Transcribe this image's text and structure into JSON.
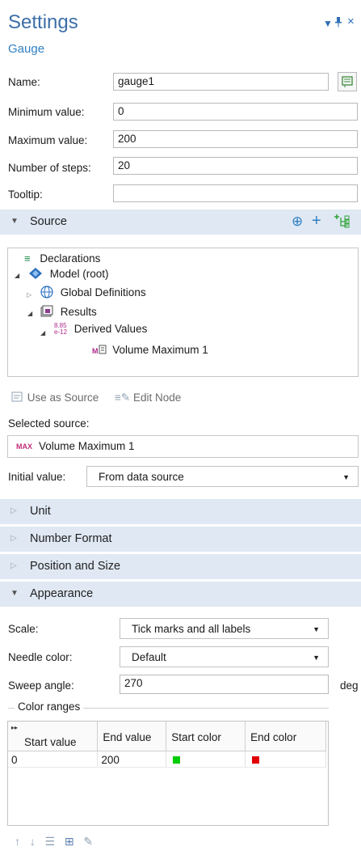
{
  "header": {
    "title": "Settings",
    "subtitle": "Gauge"
  },
  "fields": {
    "name_label": "Name:",
    "name_value": "gauge1",
    "min_label": "Minimum value:",
    "min_value": "0",
    "max_label": "Maximum value:",
    "max_value": "200",
    "steps_label": "Number of steps:",
    "steps_value": "20",
    "tooltip_label": "Tooltip:",
    "tooltip_value": ""
  },
  "source": {
    "title": "Source",
    "tree": {
      "declarations": "Declarations",
      "model": "Model (root)",
      "global_definitions": "Global Definitions",
      "results": "Results",
      "derived_values_icon_top": "8.85",
      "derived_values_icon_bottom": "e-12",
      "derived_values": "Derived Values",
      "volume_max_icon": "M",
      "volume_max": "Volume Maximum 1"
    },
    "use_as_source": "Use as Source",
    "edit_node": "Edit Node",
    "selected_label": "Selected source:",
    "selected_tag": "MAX",
    "selected_value": "Volume Maximum 1",
    "initial_label": "Initial value:",
    "initial_value": "From data source"
  },
  "sections": {
    "unit": "Unit",
    "number_format": "Number Format",
    "position_size": "Position and Size",
    "appearance": "Appearance"
  },
  "appearance": {
    "scale_label": "Scale:",
    "scale_value": "Tick marks and all labels",
    "needle_label": "Needle color:",
    "needle_value": "Default",
    "sweep_label": "Sweep angle:",
    "sweep_value": "270",
    "sweep_unit": "deg",
    "color_ranges_label": "Color ranges",
    "table": {
      "headers": [
        "Start value",
        "End value",
        "Start color",
        "End color"
      ],
      "rows": [
        {
          "start": "0",
          "end": "200",
          "start_color": "#00cc00",
          "end_color": "#e00000"
        }
      ]
    }
  },
  "colors": {
    "accent": "#3c6fa8",
    "section_bg": "#dfe8f3",
    "add_green": "#2fa33a"
  }
}
